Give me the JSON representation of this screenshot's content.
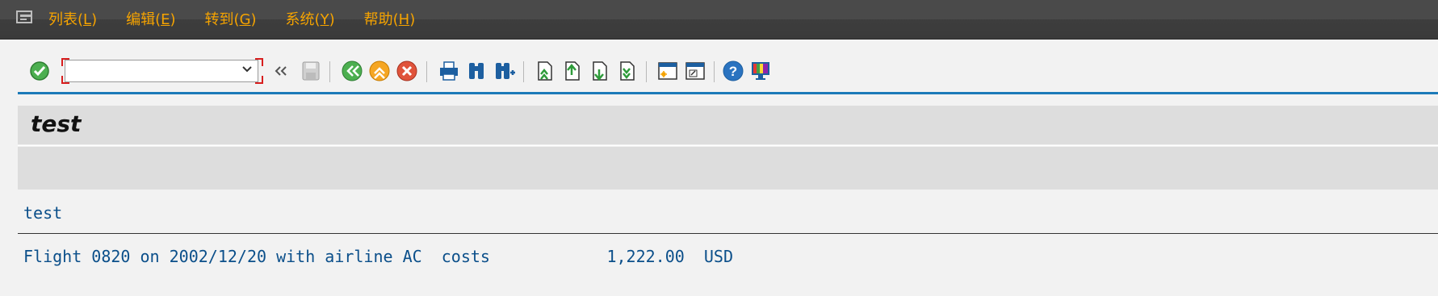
{
  "menu": {
    "items": [
      {
        "label": "列表(",
        "key": "L",
        "end": ")"
      },
      {
        "label": "编辑(",
        "key": "E",
        "end": ")"
      },
      {
        "label": "转到(",
        "key": "G",
        "end": ")"
      },
      {
        "label": "系统(",
        "key": "Y",
        "end": ")"
      },
      {
        "label": "帮助(",
        "key": "H",
        "end": ")"
      }
    ]
  },
  "toolbar": {
    "command_field_value": "",
    "icons": [
      "enter-check-icon",
      "expand-double-chevron-icon",
      "save-icon",
      "back-icon",
      "exit-icon",
      "cancel-icon",
      "print-icon",
      "find-icon",
      "find-next-icon",
      "first-page-icon",
      "previous-page-icon",
      "next-page-icon",
      "last-page-icon",
      "create-session-icon",
      "generate-shortcut-icon",
      "help-icon",
      "customize-layout-icon"
    ],
    "colors": {
      "accent_line": "#1b7ab8",
      "menu_text": "#f5a300",
      "enter_icon": "#4caf50"
    }
  },
  "page": {
    "title": "test"
  },
  "list": {
    "heading": "test",
    "lines": [
      "Flight 0820 on 2002/12/20 with airline AC  costs            1,222.00  USD"
    ]
  }
}
